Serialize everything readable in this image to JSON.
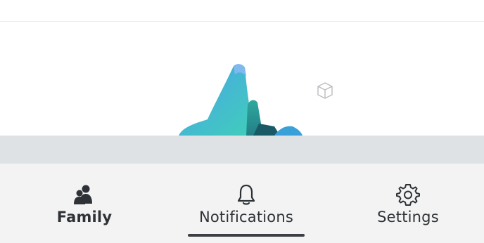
{
  "bottom_nav": {
    "items": [
      {
        "label": "Family",
        "icon": "family-icon",
        "active": false
      },
      {
        "label": "Notifications",
        "icon": "bell-icon",
        "active": true
      },
      {
        "label": "Settings",
        "icon": "gear-icon",
        "active": false
      }
    ]
  },
  "illustration": {
    "name": "cityscape-illustration",
    "badge_icon": "cube-icon"
  },
  "colors": {
    "nav_background": "#f3f3f3",
    "band": "#dfe2e5",
    "text": "#2e3236",
    "accent_underline": "#3b3f44"
  }
}
